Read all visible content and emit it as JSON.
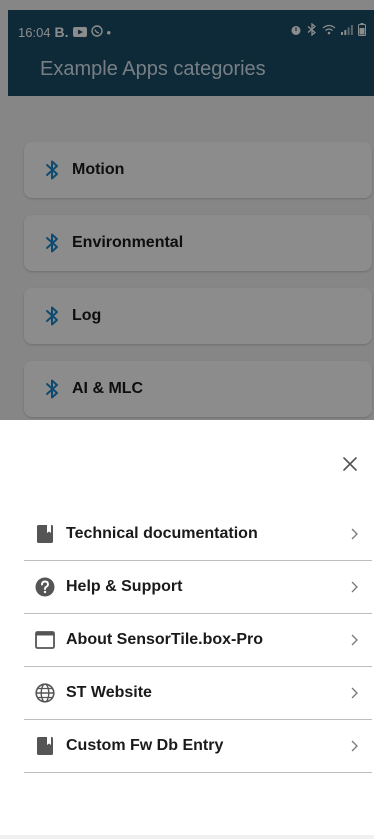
{
  "status_bar": {
    "time": "16:04",
    "indicator_b": "B.",
    "dot": "•"
  },
  "app_bar": {
    "title": "Example Apps categories"
  },
  "categories": [
    {
      "label": "Motion"
    },
    {
      "label": "Environmental"
    },
    {
      "label": "Log"
    },
    {
      "label": "AI & MLC"
    }
  ],
  "sheet": {
    "items": [
      {
        "label": "Technical documentation",
        "icon": "book-icon"
      },
      {
        "label": "Help & Support",
        "icon": "help-icon"
      },
      {
        "label": "About SensorTile.box-Pro",
        "icon": "window-icon"
      },
      {
        "label": "ST Website",
        "icon": "globe-icon"
      },
      {
        "label": "Custom Fw Db Entry",
        "icon": "book-icon"
      }
    ]
  },
  "colors": {
    "app_bar": "#1b4e66",
    "accent": "#1e88c8",
    "icon_gray": "#555555"
  }
}
